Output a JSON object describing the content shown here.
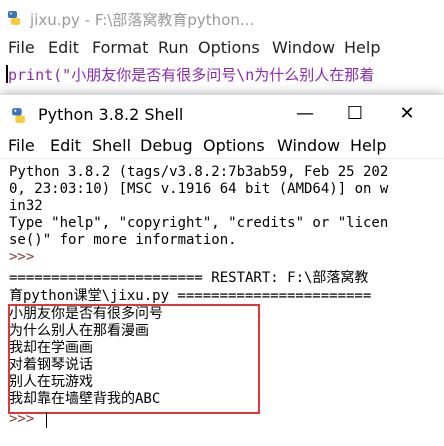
{
  "editor": {
    "title": "jixu.py - F:\\部落窝教育python...",
    "menu": [
      "File",
      "Edit",
      "Format",
      "Run",
      "Options",
      "Window",
      "Help"
    ],
    "code_line": "print(\"小朋友你是否有很多问号\\n为什么别人在那着"
  },
  "shell": {
    "title": "Python 3.8.2 Shell",
    "buttons": {
      "minimize": "—",
      "maximize": "☐",
      "close": "✕"
    },
    "menu": {
      "file": "File",
      "edit": "Edit",
      "shell": "Shell",
      "debug": "Debug",
      "options": "Options",
      "window": "Window",
      "help": "Help"
    },
    "banner": [
      "Python 3.8.2 (tags/v3.8.2:7b3ab59, Feb 25 202",
      "0, 23:03:10) [MSC v.1916 64 bit (AMD64)] on w",
      "in32",
      "Type \"help\", \"copyright\", \"credits\" or \"licen",
      "se()\" for more information."
    ],
    "prompt": ">>>",
    "restart_lines": [
      "======================= RESTART: F:\\部落窝教",
      "育python课堂\\jixu.py ======================="
    ],
    "output": [
      "小朋友你是否有很多问号",
      "为什么别人在那看漫画",
      "我却在学画画",
      "对着钢琴说话",
      "别人在玩游戏",
      "我却靠在墙壁背我的ABC"
    ]
  },
  "colors": {
    "prompt": "#8b3a3a",
    "string": "#8b2bb0",
    "highlight_box": "#e0353a"
  }
}
